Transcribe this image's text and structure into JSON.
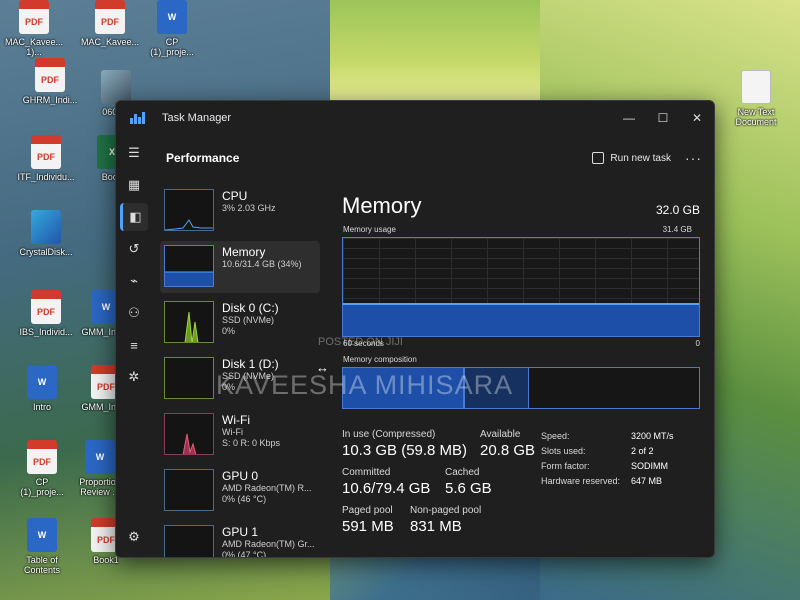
{
  "desktop_icons": [
    {
      "label": "MAC_Kavee...",
      "sub": "1)...",
      "type": "pdf"
    },
    {
      "label": "MAC_Kavee...",
      "sub": "",
      "type": "pdf"
    },
    {
      "label": "CP",
      "sub": "(1)_proje...",
      "type": "word"
    },
    {
      "label": "GHRM_Indi...",
      "sub": "",
      "type": "pdf"
    },
    {
      "label": "0605...",
      "sub": "",
      "type": "img"
    },
    {
      "label": "ITF_Individu...",
      "sub": "",
      "type": "pdf"
    },
    {
      "label": "Book",
      "sub": "",
      "type": "excel"
    },
    {
      "label": "CrystalDisk...",
      "sub": "",
      "type": "app"
    },
    {
      "label": "IBS_Individ...",
      "sub": "",
      "type": "pdf"
    },
    {
      "label": "GMM_Indi...",
      "sub": "",
      "type": "word"
    },
    {
      "label": "Intro",
      "sub": "",
      "type": "word"
    },
    {
      "label": "GMM_Indi...",
      "sub": "",
      "type": "pdf"
    },
    {
      "label": "CP",
      "sub": "(1)_proje...",
      "type": "pdf"
    },
    {
      "label": "Proportion",
      "sub": "Review ...",
      "type": "word"
    },
    {
      "label": "Table of",
      "sub": "Contents",
      "type": "word"
    },
    {
      "label": "Book1",
      "sub": "",
      "type": "pdf"
    },
    {
      "label": "New Text",
      "sub": "Document",
      "type": "text"
    }
  ],
  "window": {
    "title": "Task Manager",
    "controls": {
      "minimize": "—",
      "maximize": "☐",
      "close": "✕"
    }
  },
  "header": {
    "page_title": "Performance",
    "run_new_task": "Run new task",
    "more": "···"
  },
  "nav_icons": [
    "menu-icon",
    "processes-icon",
    "performance-icon",
    "app-history-icon",
    "startup-icon",
    "users-icon",
    "details-icon",
    "services-icon",
    "settings-icon"
  ],
  "devices": [
    {
      "title": "CPU",
      "sub1": "3%  2.03 GHz",
      "sub2": "",
      "selected": false
    },
    {
      "title": "Memory",
      "sub1": "10.6/31.4 GB (34%)",
      "sub2": "",
      "selected": true
    },
    {
      "title": "Disk 0 (C:)",
      "sub1": "SSD (NVMe)",
      "sub2": "0%",
      "selected": false
    },
    {
      "title": "Disk 1 (D:)",
      "sub1": "SSD (NVMe)",
      "sub2": "0%",
      "selected": false
    },
    {
      "title": "Wi-Fi",
      "sub1": "Wi-Fi",
      "sub2": "S: 0  R: 0 Kbps",
      "selected": false
    },
    {
      "title": "GPU 0",
      "sub1": "AMD Radeon(TM) R...",
      "sub2": "0%  (46 °C)",
      "selected": false
    },
    {
      "title": "GPU 1",
      "sub1": "AMD Radeon(TM) Gr...",
      "sub2": "0%  (47 °C)",
      "selected": false
    }
  ],
  "memory": {
    "title": "Memory",
    "total": "32.0 GB",
    "usage_caption": "Memory usage",
    "usage_max": "31.4 GB",
    "time_caption": "60 seconds",
    "zero": "0",
    "usage_fraction": 0.34,
    "composition_caption": "Memory composition",
    "composition": {
      "in_use": 0.34,
      "modified": 0.003,
      "standby": 0.18,
      "free": 0.477
    },
    "stats": {
      "in_use_label": "In use (Compressed)",
      "in_use": "10.3 GB (59.8 MB)",
      "available_label": "Available",
      "available": "20.8 GB",
      "committed_label": "Committed",
      "committed": "10.6/79.4 GB",
      "cached_label": "Cached",
      "cached": "5.6 GB",
      "paged_label": "Paged pool",
      "paged": "591 MB",
      "nonpaged_label": "Non-paged pool",
      "nonpaged": "831 MB"
    },
    "specs": [
      {
        "k": "Speed:",
        "v": "3200 MT/s"
      },
      {
        "k": "Slots used:",
        "v": "2 of 2"
      },
      {
        "k": "Form factor:",
        "v": "SODIMM"
      },
      {
        "k": "Hardware reserved:",
        "v": "647 MB"
      }
    ]
  },
  "watermark": {
    "small": "POSTED ON JIJI",
    "large": "KAVEESHA MIHISARA"
  },
  "colors": {
    "accent": "#4da3ff",
    "fill": "#1d4fa8",
    "window_bg": "#1f1f1f"
  }
}
